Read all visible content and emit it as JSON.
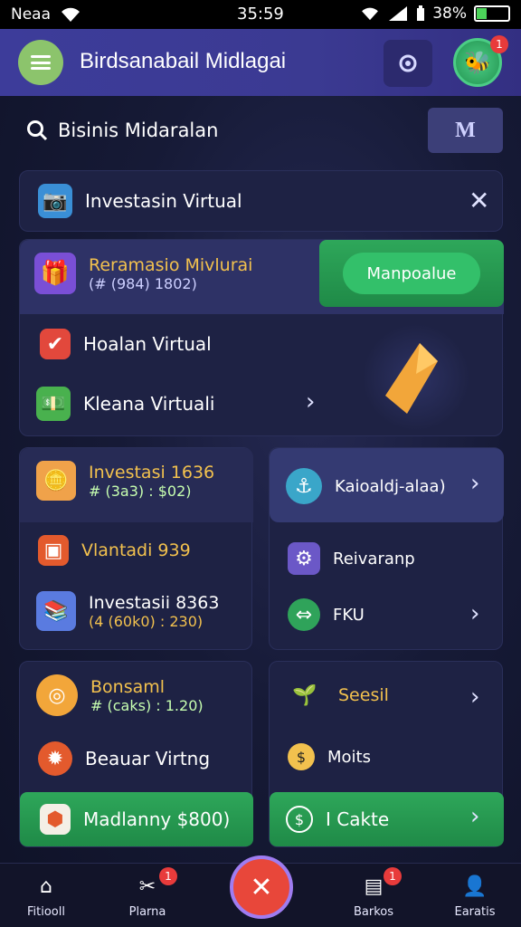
{
  "status_bar": {
    "carrier": "Neaa",
    "time": "35:59",
    "battery": "38%"
  },
  "app_bar": {
    "title": "Birdsanabail Midlagai",
    "avatar_badge": "1"
  },
  "search": {
    "text": "Bisinis Midaralan",
    "button_label": "M"
  },
  "banner": {
    "label": "Investasin Virtual"
  },
  "promo": {
    "title": "Reramasio Mivlurai",
    "sub": "(# (984) 1802)",
    "button_label": "Manpoalue"
  },
  "menu_list": [
    {
      "label": "Hoalan Virtual",
      "icon": "check-icon"
    },
    {
      "label": "Kleana Virtuali",
      "icon": "money-icon"
    }
  ],
  "left_card_1": {
    "item1": {
      "title": "Investasi 1636",
      "sub": "# (3a3) : $02)"
    },
    "item2": {
      "title": "Vlantadi 939"
    },
    "item3": {
      "title": "Investasii 8363",
      "sub": "(4 (60k0) : 230)"
    }
  },
  "right_card_1": {
    "top": {
      "label": "Kaioaldj-alaa)"
    },
    "item1": {
      "label": "Reivaranp"
    },
    "item2": {
      "label": "FKU"
    }
  },
  "left_card_2": {
    "item1": {
      "title": "Bonsaml",
      "sub": "# (caks) : 1.20)"
    },
    "item2": {
      "label": "Beauar Virtng"
    },
    "button": {
      "label": "Madlanny $800)"
    }
  },
  "right_card_2": {
    "item1": {
      "label": "Seesil"
    },
    "item2": {
      "label": "Moits"
    },
    "button": {
      "label": "I Cakte"
    }
  },
  "bottom_nav": [
    {
      "label": "Fitiooll",
      "icon": "home-icon",
      "badge": ""
    },
    {
      "label": "Plarna",
      "icon": "tools-icon",
      "badge": "1"
    },
    {
      "label": "Barkos",
      "icon": "document-icon",
      "badge": "1"
    },
    {
      "label": "Earatis",
      "icon": "person-icon",
      "badge": ""
    }
  ],
  "colors": {
    "accent_green": "#2ea75a",
    "accent_purple": "#3d3c9a",
    "badge_red": "#e83b3b",
    "gold": "#f2c14e"
  }
}
